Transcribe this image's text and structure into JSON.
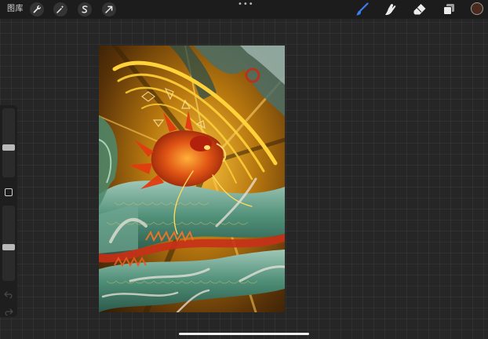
{
  "toolbar": {
    "gallery_label": "图库",
    "left_tools": [
      {
        "icon": "wrench-icon"
      },
      {
        "icon": "magic-wand-icon"
      },
      {
        "icon": "selection-s-icon"
      },
      {
        "icon": "arrow-cursor-icon"
      }
    ],
    "more_dots": "•••",
    "right_tools": [
      {
        "icon": "brush-icon",
        "active": true
      },
      {
        "icon": "smudge-icon"
      },
      {
        "icon": "eraser-icon"
      },
      {
        "icon": "layers-icon"
      }
    ],
    "current_color": "#4a2a1c",
    "active_color": "#3f7bf2"
  },
  "sidebar": {
    "brush_size_level": 0.43,
    "opacity_level": 0.44
  },
  "canvas": {
    "artwork": "dragon-illustration"
  }
}
